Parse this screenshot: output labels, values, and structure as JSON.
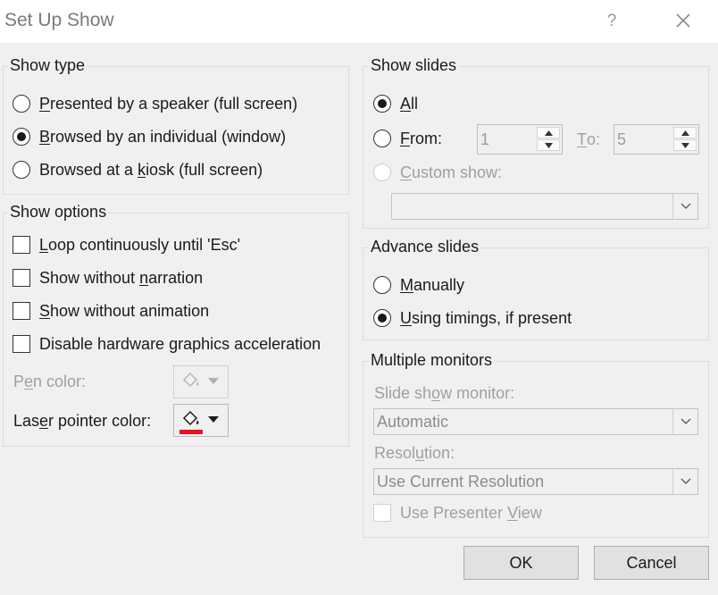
{
  "window": {
    "title": "Set Up Show",
    "help": "?"
  },
  "show_type": {
    "label": "Show type",
    "options": [
      {
        "pre": "",
        "key": "P",
        "post": "resented by a speaker (full screen)",
        "selected": false
      },
      {
        "pre": "",
        "key": "B",
        "post": "rowsed by an individual (window)",
        "selected": true
      },
      {
        "pre": "Browsed at a ",
        "key": "k",
        "post": "iosk (full screen)",
        "selected": false
      }
    ]
  },
  "show_options": {
    "label": "Show options",
    "checks": [
      {
        "pre": "",
        "key": "L",
        "post": "oop continuously until 'Esc'",
        "checked": false
      },
      {
        "pre": "Show without ",
        "key": "n",
        "post": "arration",
        "checked": false
      },
      {
        "pre": "",
        "key": "S",
        "post": "how without animation",
        "checked": false
      },
      {
        "pre": "Disable hardware ",
        "key": "g",
        "post": "raphics acceleration",
        "checked": false
      }
    ],
    "pen_color": {
      "pre": "P",
      "key": "e",
      "post": "n color:"
    },
    "laser_color": {
      "pre": "Las",
      "key": "e",
      "post": "r pointer color:",
      "swatch": "#e81123"
    }
  },
  "show_slides": {
    "label": "Show slides",
    "all": {
      "pre": "",
      "key": "A",
      "post": "ll",
      "selected": true
    },
    "from": {
      "pre": "",
      "key": "F",
      "post": "rom:",
      "selected": false,
      "value": "1"
    },
    "to": {
      "pre": "",
      "key": "T",
      "post": "o:",
      "value": "5"
    },
    "custom": {
      "pre": "",
      "key": "C",
      "post": "ustom show:",
      "selected": false,
      "value": ""
    }
  },
  "advance_slides": {
    "label": "Advance slides",
    "manually": {
      "pre": "",
      "key": "M",
      "post": "anually",
      "selected": false
    },
    "timings": {
      "pre": "",
      "key": "U",
      "post": "sing timings, if present",
      "selected": true
    }
  },
  "monitors": {
    "label": "Multiple monitors",
    "monitor_label": {
      "pre": "Slide sh",
      "key": "o",
      "post": "w monitor:"
    },
    "monitor_value": "Automatic",
    "resolution_label": {
      "pre": "Resol",
      "key": "u",
      "post": "tion:"
    },
    "resolution_value": "Use Current Resolution",
    "presenter": {
      "pre": "Use Presenter ",
      "key": "V",
      "post": "iew",
      "checked": false
    }
  },
  "buttons": {
    "ok": "OK",
    "cancel": "Cancel"
  }
}
